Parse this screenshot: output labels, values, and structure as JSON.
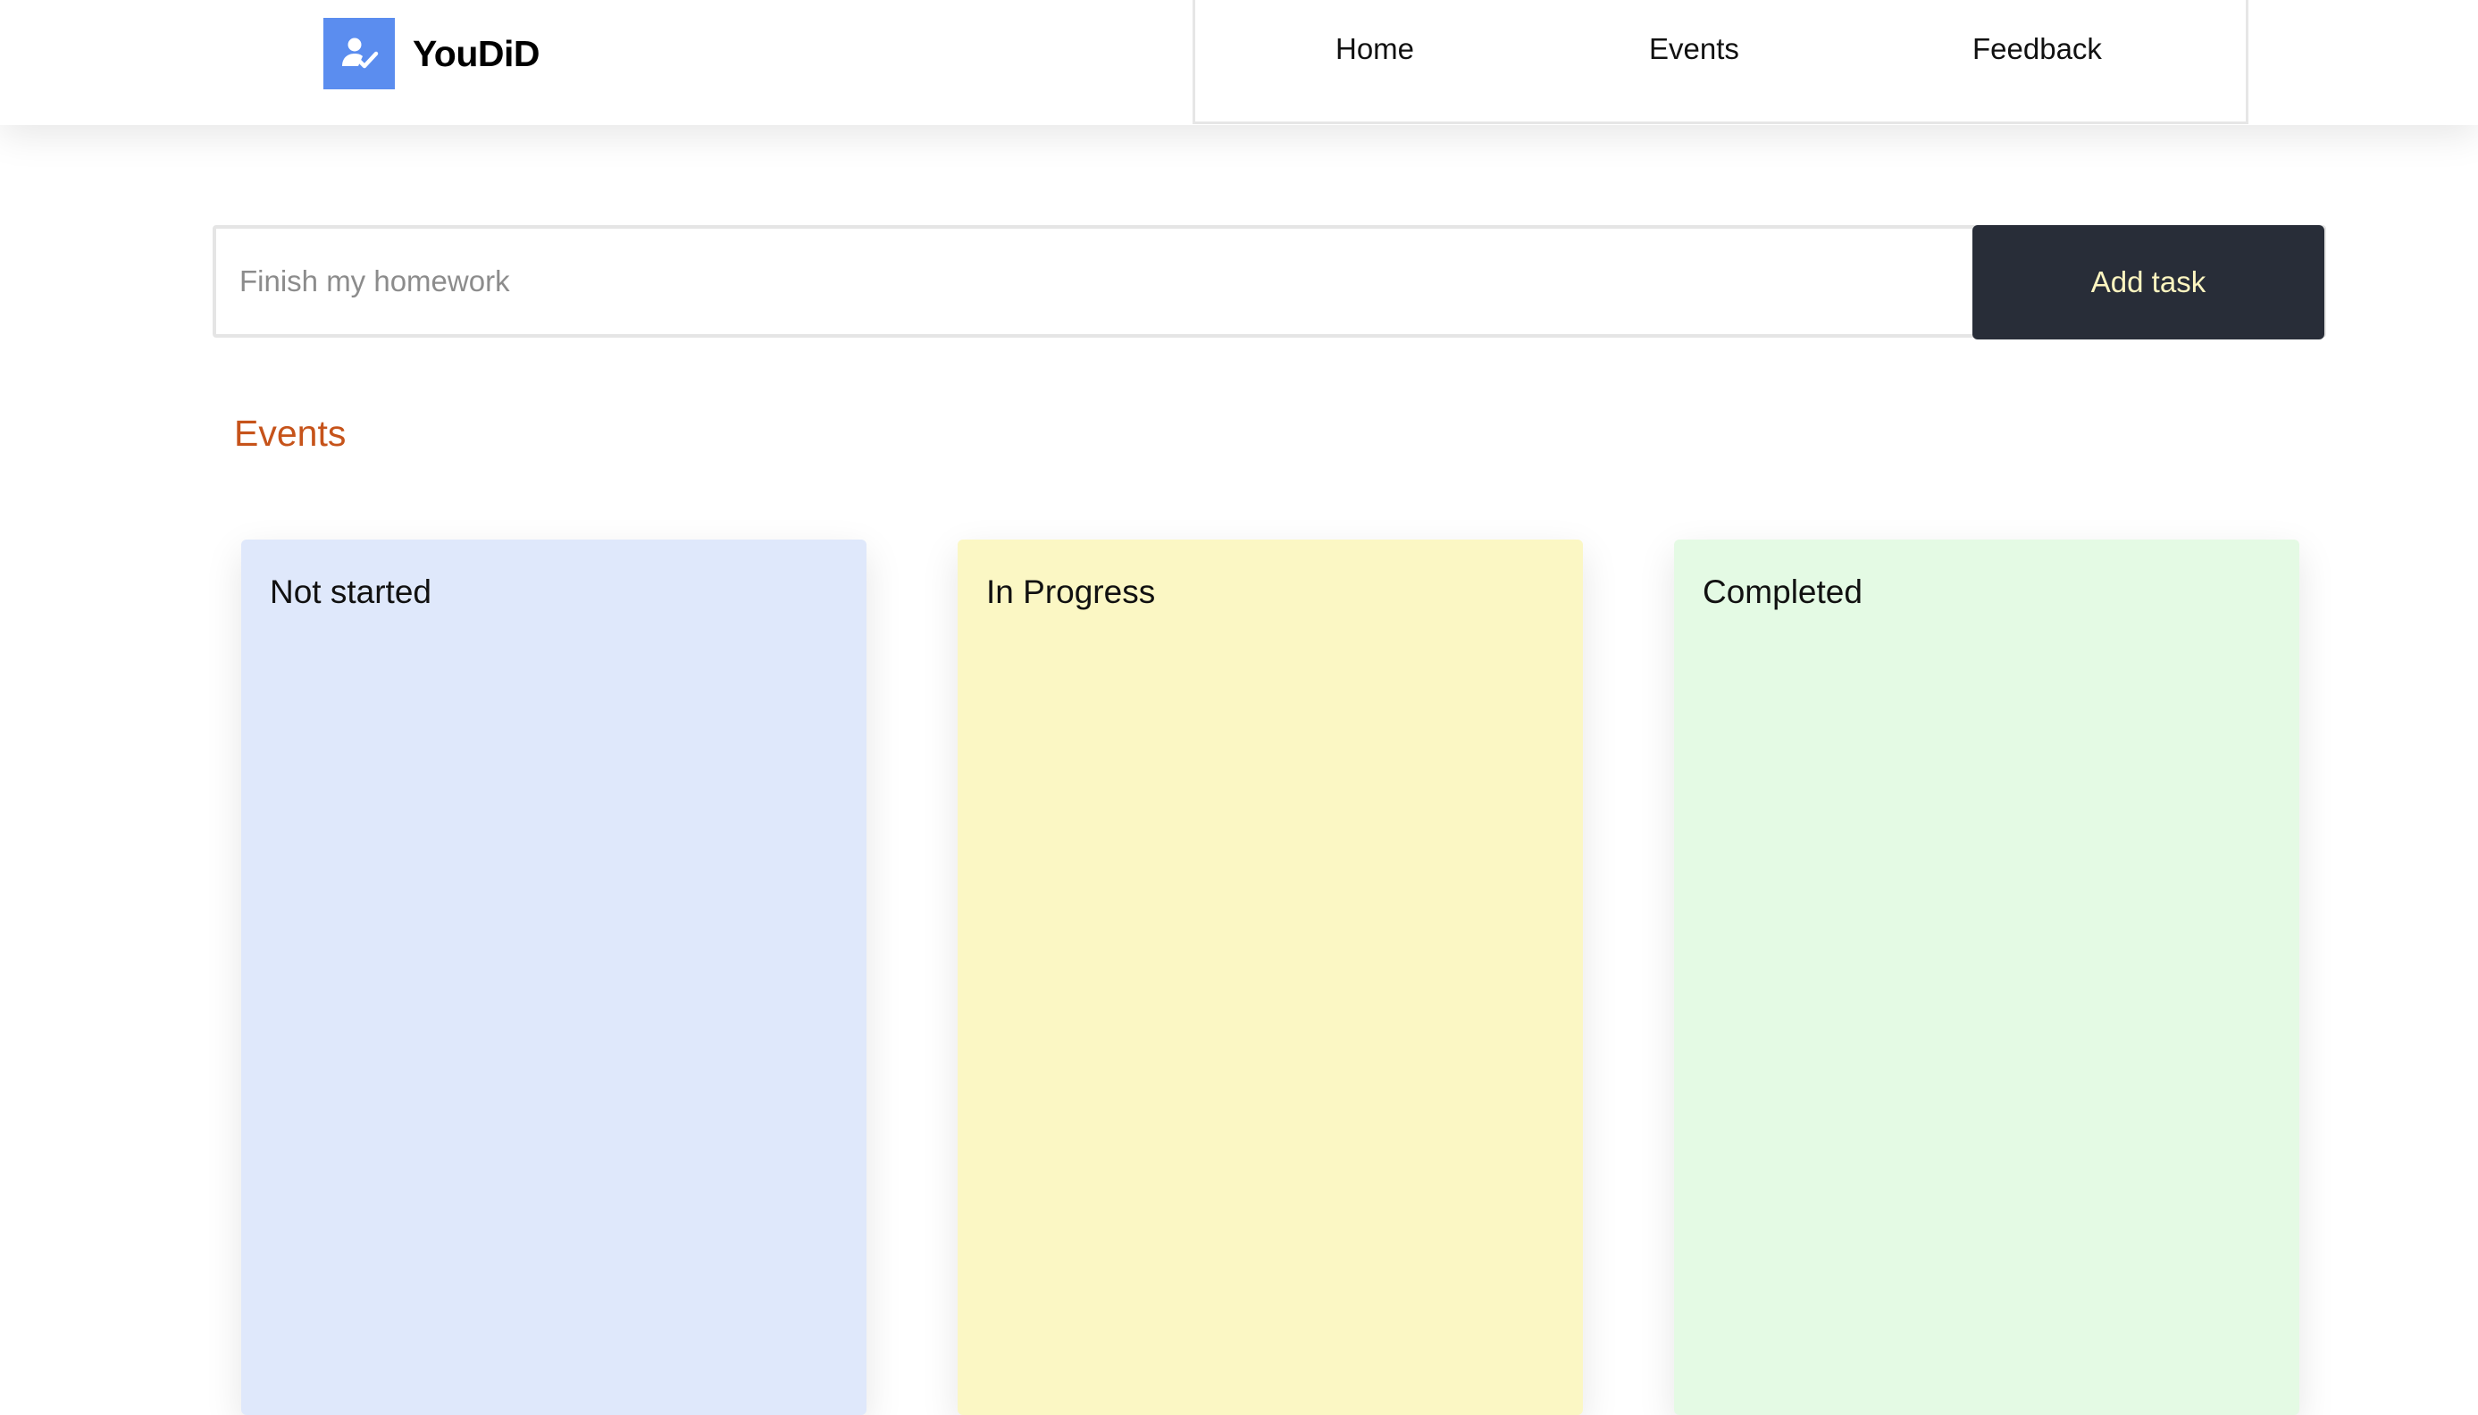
{
  "header": {
    "brand": "YouDiD",
    "logo_icon": "user-check-icon",
    "logo_color": "#5b8def",
    "nav": [
      {
        "label": "Home"
      },
      {
        "label": "Events"
      },
      {
        "label": "Feedback"
      }
    ]
  },
  "task_form": {
    "input_value": "",
    "input_placeholder": "Finish my homework",
    "add_button_label": "Add task",
    "button_color": "#282d38"
  },
  "section": {
    "title": "Events",
    "title_color": "#c6531a"
  },
  "columns": [
    {
      "title": "Not started",
      "color": "#dfe8fb",
      "items": []
    },
    {
      "title": "In Progress",
      "color": "#fbf7c4",
      "items": []
    },
    {
      "title": "Completed",
      "color": "#e4fae4",
      "items": []
    }
  ]
}
